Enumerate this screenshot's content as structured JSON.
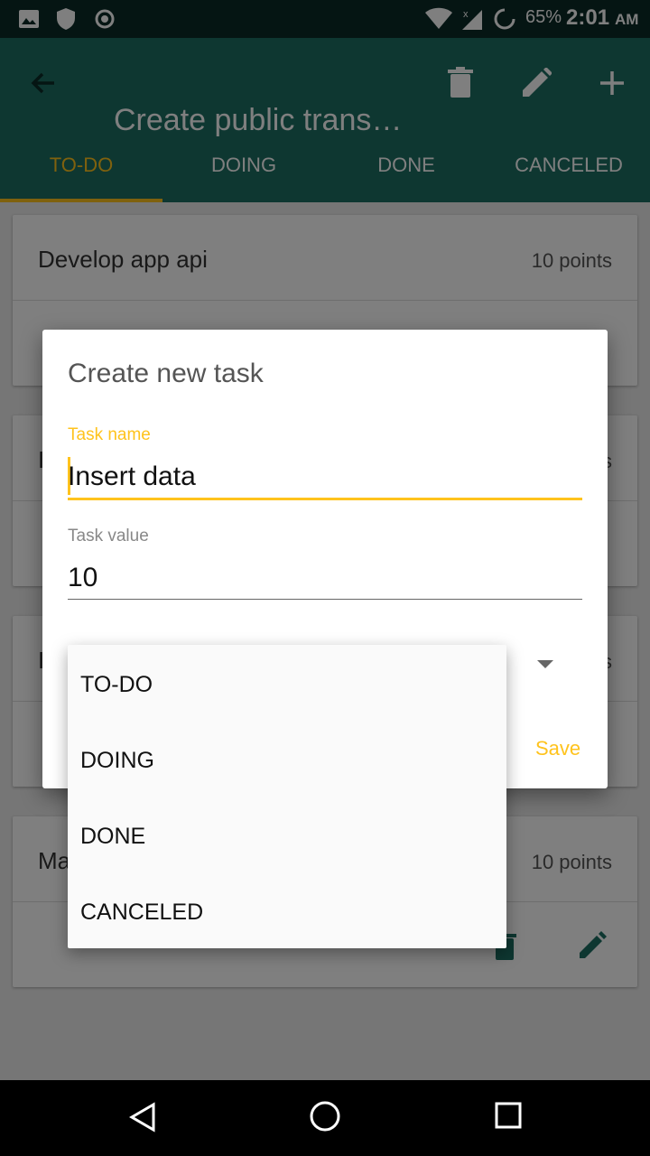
{
  "status": {
    "battery": "65%",
    "time": "2:01",
    "ampm": "AM"
  },
  "app_bar": {
    "title": "Create public trans…",
    "icons": [
      "back-arrow-icon",
      "trash-icon",
      "pencil-icon",
      "plus-icon"
    ]
  },
  "tabs": [
    "TO-DO",
    "DOING",
    "DONE",
    "CANCELED"
  ],
  "active_tab": "TO-DO",
  "tasks": [
    {
      "name": "Develop app api",
      "points": "10 points"
    },
    {
      "name": "I",
      "points": "s"
    },
    {
      "name": "I",
      "points": "s"
    },
    {
      "name": "Ma",
      "points": "10 points"
    }
  ],
  "dialog": {
    "title": "Create new task",
    "task_name_label": "Task name",
    "task_name_value": "Insert data",
    "task_value_label": "Task value",
    "task_value_value": "10",
    "save_label": "Save"
  },
  "dropdown_options": [
    "TO-DO",
    "DOING",
    "DONE",
    "CANCELED"
  ],
  "colors": {
    "primary": "#1d6e63",
    "status_bar": "#0b2b26",
    "accent": "#ffc31d"
  }
}
